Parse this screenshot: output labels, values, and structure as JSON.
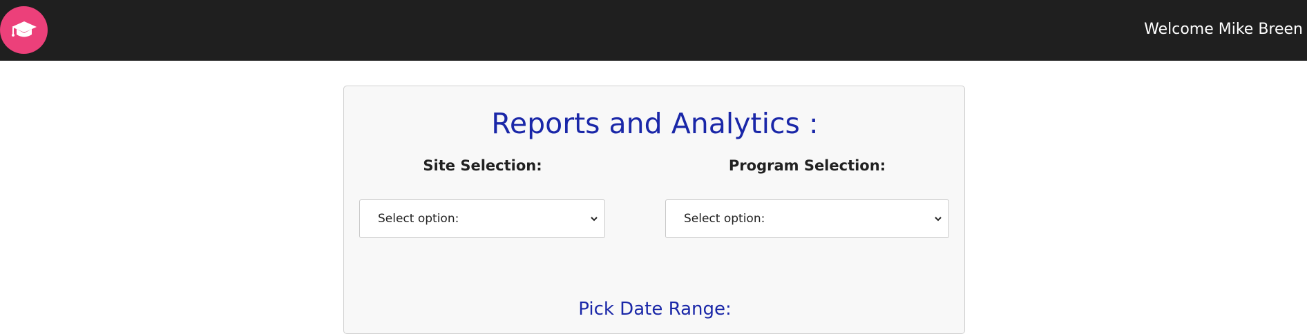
{
  "header": {
    "welcome_text": "Welcome Mike Breen",
    "logo_icon": "graduation-cap-icon",
    "colors": {
      "bar": "#1f1f1f",
      "logo": "#ec407a"
    }
  },
  "main": {
    "title": "Reports and Analytics :",
    "site_selection": {
      "label": "Site Selection:",
      "value": "Select option:"
    },
    "program_selection": {
      "label": "Program Selection:",
      "value": "Select option:"
    },
    "date_range_label": "Pick Date Range:",
    "colors": {
      "heading": "#1a27a8",
      "panel": "#f8f8f8"
    }
  }
}
